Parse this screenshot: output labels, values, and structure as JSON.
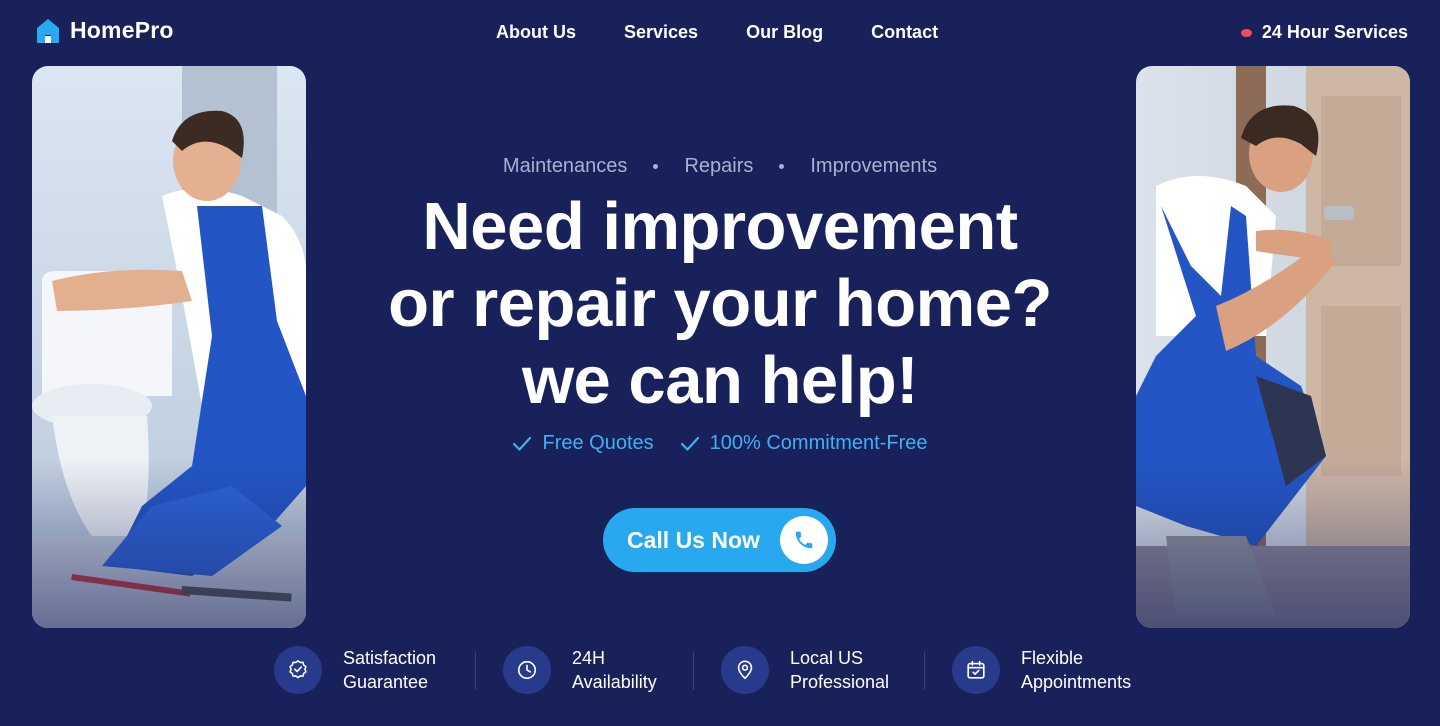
{
  "brand": {
    "name": "HomePro",
    "icon": "house-icon",
    "accent": "#29a9f0"
  },
  "nav": {
    "items": [
      {
        "label": "About Us"
      },
      {
        "label": "Services"
      },
      {
        "label": "Our Blog"
      },
      {
        "label": "Contact"
      }
    ]
  },
  "header": {
    "hours_label": "24 Hour Services",
    "hours_dot_color": "#ef4d5d"
  },
  "hero": {
    "eyebrow": [
      "Maintenances",
      "Repairs",
      "Improvements"
    ],
    "headline_lines": [
      "Need improvement",
      "or repair your home?",
      "we can help!"
    ],
    "checks": [
      "Free Quotes",
      "100% Commitment-Free"
    ],
    "cta_label": "Call Us Now",
    "cta_icon": "phone-icon"
  },
  "photos": {
    "left": {
      "subject": "plumber-repairing-toilet"
    },
    "right": {
      "subject": "handyman-fixing-door-lock"
    }
  },
  "features": [
    {
      "line1": "Satisfaction",
      "line2": "Guarantee",
      "icon": "badge-check-icon"
    },
    {
      "line1": "24H",
      "line2": "Availability",
      "icon": "clock-icon"
    },
    {
      "line1": "Local US",
      "line2": "Professional",
      "icon": "location-pin-icon"
    },
    {
      "line1": "Flexible",
      "line2": "Appointments",
      "icon": "calendar-check-icon"
    }
  ]
}
